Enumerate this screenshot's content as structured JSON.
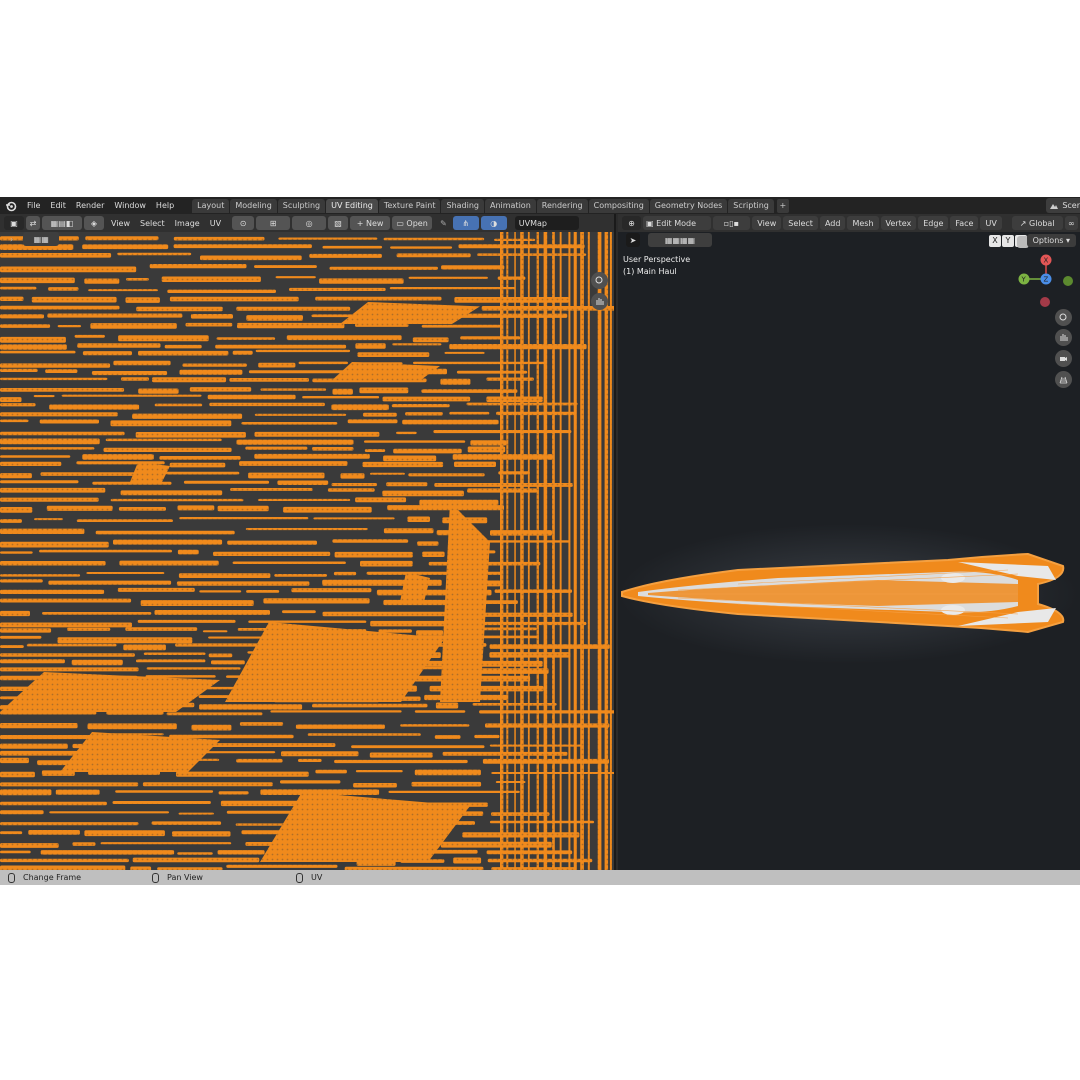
{
  "menu": {
    "file": "File",
    "edit": "Edit",
    "render": "Render",
    "window": "Window",
    "help": "Help"
  },
  "workspace_tabs": [
    "Layout",
    "Modeling",
    "Sculpting",
    "UV Editing",
    "Texture Paint",
    "Shading",
    "Animation",
    "Rendering",
    "Compositing",
    "Geometry Nodes",
    "Scripting"
  ],
  "active_tab": "UV Editing",
  "tab_add": "+",
  "scene_label": "Scer",
  "uv_editor": {
    "menus": {
      "view": "View",
      "select": "Select",
      "image": "Image",
      "uv": "UV"
    },
    "new_label": "New",
    "open_label": "Open",
    "uvmap": "UVMap"
  },
  "viewport": {
    "mode": "Edit Mode",
    "menus": {
      "view": "View",
      "select": "Select",
      "add": "Add",
      "mesh": "Mesh",
      "vertex": "Vertex",
      "edge": "Edge",
      "face": "Face",
      "uv": "UV"
    },
    "transform_orientation": "Global",
    "perspective_label": "User Perspective",
    "object_label": "(1) Main Haul",
    "axis_lock": [
      "X",
      "Y",
      "Z"
    ],
    "options_label": "Options",
    "gizmo_axes": {
      "x": "X",
      "y": "Y",
      "z": "Z"
    }
  },
  "status_bar": {
    "left": "Change Frame",
    "middle": "Pan View",
    "right": "UV"
  },
  "colors": {
    "uv_orange": "#f08a1c",
    "header_bg": "#303030",
    "viewport_bg": "#1d2024",
    "status_bg": "#bfbfbf"
  }
}
